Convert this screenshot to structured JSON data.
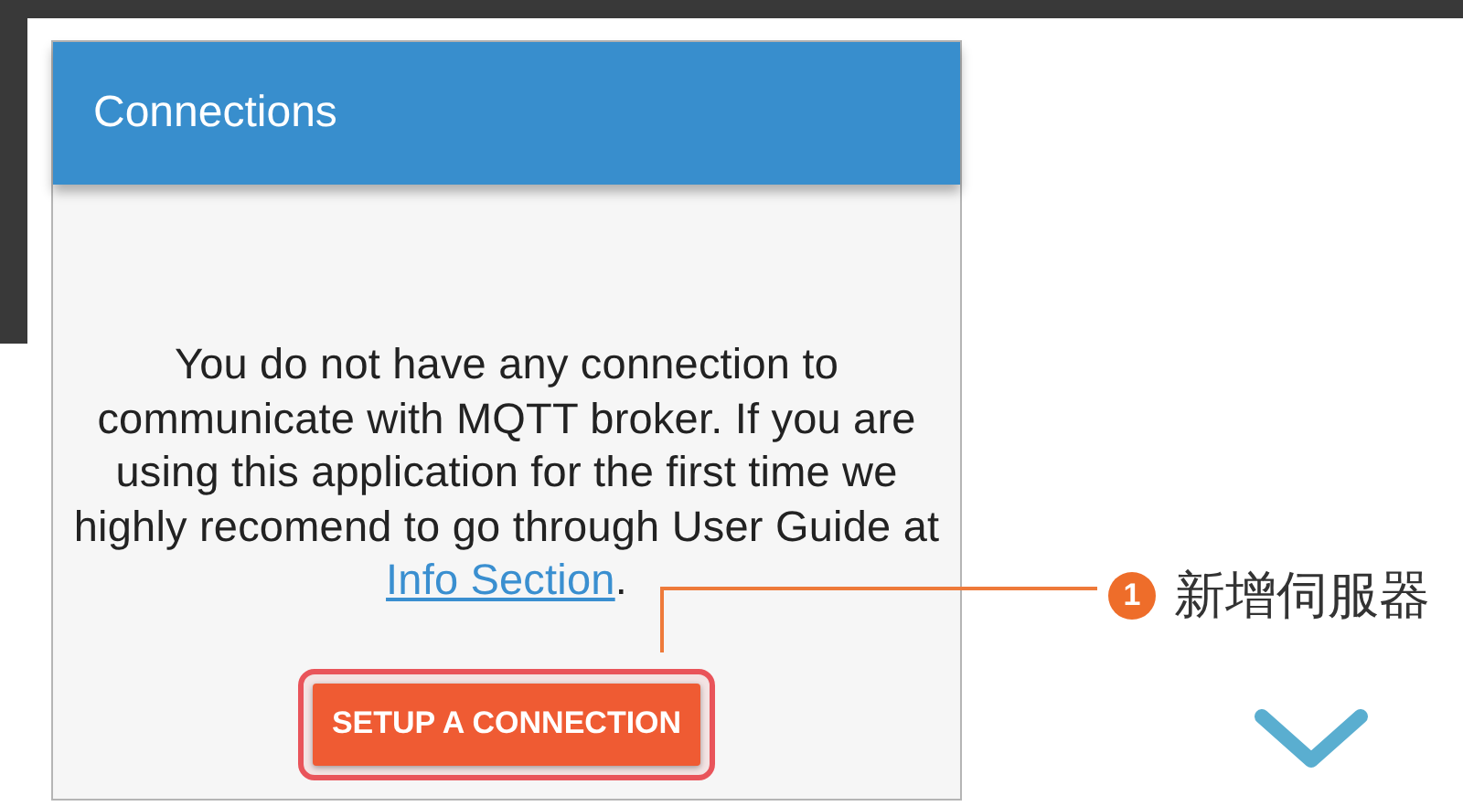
{
  "app_bar": {
    "title": "Connections"
  },
  "empty_state": {
    "message": "You do not have any connection to communicate with MQTT broker. If you are using this application for the first time we highly recomend to go through User Guide at",
    "link": "Info Section",
    "message_end": "."
  },
  "button": {
    "label": "SETUP A CONNECTION",
    "highlighted": true
  },
  "callout": {
    "number": "1",
    "label": "新增伺服器"
  }
}
